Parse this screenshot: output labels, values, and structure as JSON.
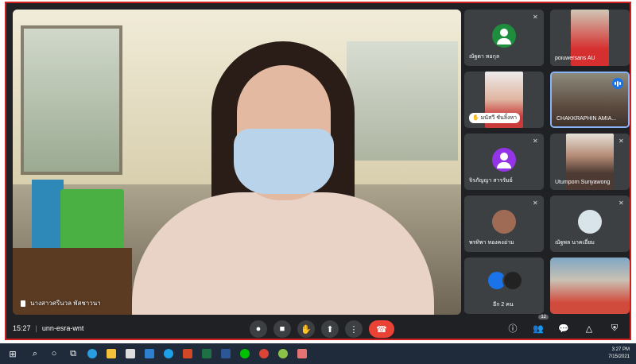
{
  "main_speaker": {
    "name": "นางสาวศรีนวล พัสชาวนา"
  },
  "participants": [
    {
      "name": "ณัฐดา หอกุล",
      "avatar_color": "#1e8e3e",
      "muted": true
    },
    {
      "name": "poiuwersans AU",
      "muted": false,
      "video": true
    },
    {
      "name": "มนัสวี ชันลิ้งหา",
      "muted": false,
      "video": true,
      "hand_raised": true
    },
    {
      "name": "CHAKKRAPHIN AMIA...",
      "muted": false,
      "video": true,
      "speaking": true
    },
    {
      "name": "จิรภัญญา สารรัมย์",
      "avatar_color": "#9334e6",
      "muted": true
    },
    {
      "name": "Utumporn Suriyawong",
      "muted": true,
      "video": true
    },
    {
      "name": "พรทิพา หองคงอ่าม",
      "muted": true,
      "video": true
    },
    {
      "name": "ณัฐพล นาคเอี่ยม",
      "muted": true,
      "video": true
    },
    {
      "name": "อีก 2 คน",
      "muted": false,
      "others": true
    },
    {
      "name": "",
      "video": true
    }
  ],
  "bottom_bar": {
    "time": "15:27",
    "separator": "|",
    "meeting_code": "unn-esra-wnt",
    "participants_count": "12",
    "icons": [
      "info-icon",
      "people-icon",
      "chat-icon",
      "activities-icon",
      "host-controls-icon"
    ]
  },
  "controls": [
    "mic-icon",
    "camera-icon",
    "raise-hand-icon",
    "present-icon",
    "more-options-icon",
    "end-call-icon"
  ],
  "taskbar": {
    "time": "3:27 PM",
    "date": "7/15/2021"
  },
  "colors": {
    "end_call": "#ea4335",
    "meet_bg": "#202124",
    "tile_bg": "#3c4043",
    "speaking_border": "#8ab4f8"
  }
}
